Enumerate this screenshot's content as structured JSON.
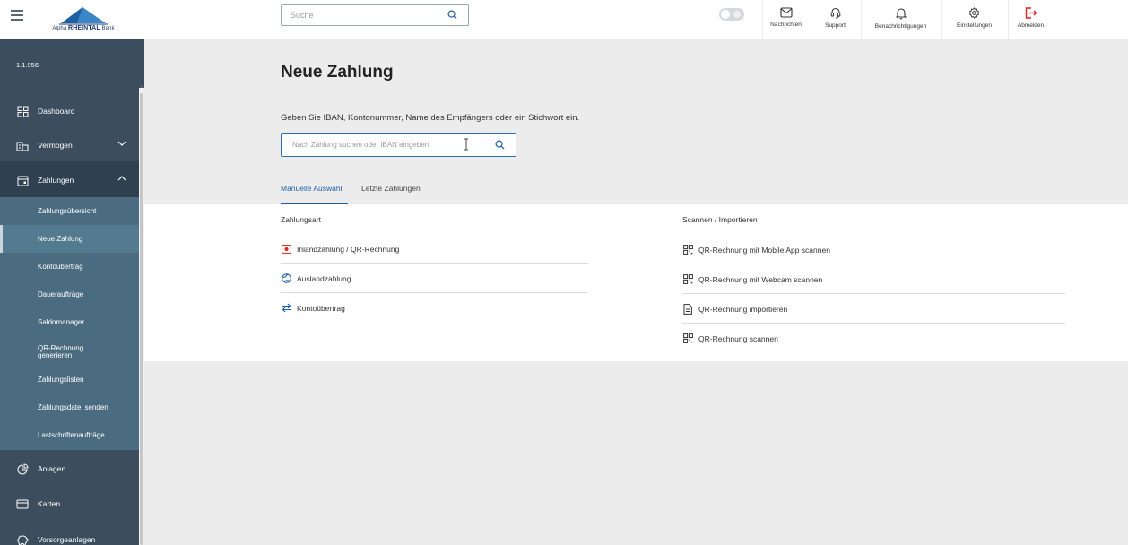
{
  "brand": {
    "name_small": "Alpha",
    "name_bold": "RHEINTAL",
    "name_rest": "Bank"
  },
  "topbar": {
    "search_placeholder": "Suche",
    "buttons": [
      {
        "label": "Nachrichten",
        "icon": "mail-icon"
      },
      {
        "label": "Support",
        "icon": "headset-icon"
      },
      {
        "label": "Benachrichtigungen",
        "icon": "bell-icon"
      },
      {
        "label": "Einstellungen",
        "icon": "gear-icon"
      },
      {
        "label": "Abmelden",
        "icon": "logout-icon"
      }
    ],
    "logout_color": "#e2231a"
  },
  "sidebar": {
    "version": "1.1.956",
    "items": [
      {
        "label": "Dashboard",
        "icon": "dashboard-icon"
      },
      {
        "label": "Vermögen",
        "icon": "assets-icon"
      },
      {
        "label": "Zahlungen",
        "icon": "payments-icon"
      },
      {
        "label": "Anlagen",
        "icon": "chart-pie-icon"
      },
      {
        "label": "Karten",
        "icon": "card-icon"
      },
      {
        "label": "Vorsorgeanlagen",
        "icon": "piggy-bank-icon"
      }
    ],
    "payments_sub": [
      {
        "label": "Zahlungsübersicht"
      },
      {
        "label": "Neue Zahlung"
      },
      {
        "label": "Kontoübertrag"
      },
      {
        "label": "Daueraufträge"
      },
      {
        "label": "Saldomanager"
      },
      {
        "label": "QR-Rechnung generieren"
      },
      {
        "label": "Zahlungslisten"
      },
      {
        "label": "Zahlungsdatei senden"
      },
      {
        "label": "Lastschriftenaufträge"
      }
    ],
    "active_sub": "Neue Zahlung"
  },
  "main": {
    "title": "Neue Zahlung",
    "hint": "Geben Sie IBAN, Kontonummer, Name des Empfängers oder ein Stichwort ein.",
    "search_placeholder": "Nach Zahlung suchen oder IBAN eingeben",
    "tabs": [
      {
        "label": "Manuelle Auswahl",
        "active": true
      },
      {
        "label": "Letzte Zahlungen",
        "active": false
      }
    ],
    "payment_types": {
      "heading": "Zahlungsart",
      "items": [
        {
          "label": "Inlandzahlung / QR-Rechnung",
          "icon": "qr-bill-icon"
        },
        {
          "label": "Auslandzahlung",
          "icon": "globe-icon"
        },
        {
          "label": "Kontoübertrag",
          "icon": "transfer-arrows-icon"
        }
      ]
    },
    "scan_import": {
      "heading": "Scannen / Importieren",
      "items": [
        {
          "label": "QR-Rechnung mit Mobile App scannen",
          "icon": "qr-code-icon"
        },
        {
          "label": "QR-Rechnung mit Webcam scannen",
          "icon": "qr-code-icon"
        },
        {
          "label": "QR-Rechnung importieren",
          "icon": "document-icon"
        },
        {
          "label": "QR-Rechnung scannen",
          "icon": "qr-code-icon"
        }
      ]
    }
  },
  "colors": {
    "sidebar_bg": "#3c4e5e",
    "submenu_bg": "#4a6b80",
    "accent": "#1e5fa4",
    "content_bg": "#ececec"
  }
}
